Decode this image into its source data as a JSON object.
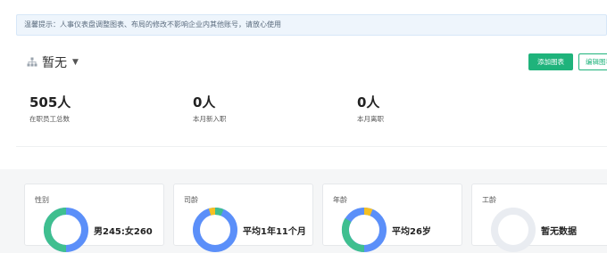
{
  "notice": {
    "text": "温馨提示：人事仪表盘调整图表、布局的修改不影响企业内其他账号，请放心使用"
  },
  "header": {
    "org_icon": "org-tree-icon",
    "org_name": "暂无",
    "add_chart_label": "添加图表",
    "edit_layout_label": "编辑图表"
  },
  "stats": [
    {
      "value": "505人",
      "label": "在职员工总数"
    },
    {
      "value": "0人",
      "label": "本月新入职"
    },
    {
      "value": "0人",
      "label": "本月离职"
    }
  ],
  "cards": [
    {
      "title": "性别",
      "value": "男245:女260"
    },
    {
      "title": "司龄",
      "value": "平均1年11个月"
    },
    {
      "title": "年龄",
      "value": "平均26岁"
    },
    {
      "title": "工龄",
      "value": "暂无数据"
    }
  ],
  "colors": {
    "primary": "#1fb37b",
    "blue": "#5b8ff9",
    "green": "#3fbf8f",
    "yellow": "#f6c022",
    "empty": "#e9ecf1"
  }
}
